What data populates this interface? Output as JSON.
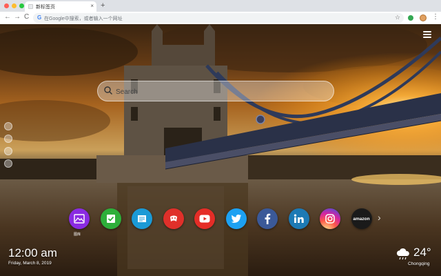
{
  "browser": {
    "tab_title": "新标签页",
    "tab_close": "×",
    "new_tab": "+",
    "back": "←",
    "forward": "→",
    "reload": "C",
    "omnibox_g": "G",
    "omnibox_placeholder": "在Google中搜索，或者输入一个网址",
    "bookmark_star": "☆",
    "chrome_menu": "⋮"
  },
  "page": {
    "background": "Tower Bridge at sunset",
    "search_placeholder": "Search",
    "apps": [
      {
        "name": "gallery",
        "icon": "gallery-icon",
        "color": "#8a2be2",
        "label": "图库"
      },
      {
        "name": "todo",
        "icon": "checklist-icon",
        "color": "#2eaf3a"
      },
      {
        "name": "notes",
        "icon": "notes-icon",
        "color": "#1b9ad6"
      },
      {
        "name": "games",
        "icon": "gamepad-icon",
        "color": "#e0302a"
      },
      {
        "name": "youtube",
        "icon": "youtube-icon",
        "color": "#e52d27"
      },
      {
        "name": "twitter",
        "icon": "twitter-icon",
        "color": "#1da1f2"
      },
      {
        "name": "facebook",
        "icon": "facebook-icon",
        "color": "#3b5998"
      },
      {
        "name": "linkedin",
        "icon": "linkedin-icon",
        "color": "#1d7ab5"
      },
      {
        "name": "instagram",
        "icon": "instagram-icon",
        "color": "#d6249f"
      },
      {
        "name": "amazon",
        "icon": "amazon-icon",
        "color": "#1a1a1a",
        "text": "amazon"
      }
    ],
    "next_arrow": "›",
    "time": "12:00 am",
    "date": "Friday, March 8, 2019",
    "temperature": "24°",
    "city": "Chongqing",
    "weather_icon": "cloud-rain-icon"
  }
}
